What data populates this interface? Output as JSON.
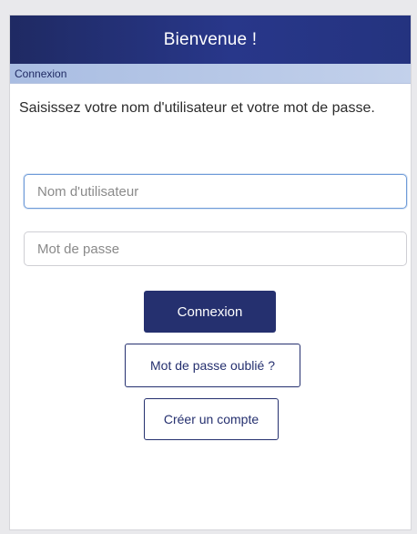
{
  "header": {
    "title": "Bienvenue !"
  },
  "subbar": {
    "label": "Connexion"
  },
  "form": {
    "instruction": "Saisissez votre nom d'utilisateur et votre mot de passe.",
    "username_placeholder": "Nom d'utilisateur",
    "username_value": "",
    "password_placeholder": "Mot de passe",
    "password_value": "",
    "login_label": "Connexion",
    "forgot_label": "Mot de passe oublié ?",
    "create_label": "Créer un compte"
  },
  "colors": {
    "header_bg": "#25306f",
    "subbar_bg": "#b9c9e8",
    "accent": "#25306f",
    "focus_border": "#6f9bd8"
  }
}
